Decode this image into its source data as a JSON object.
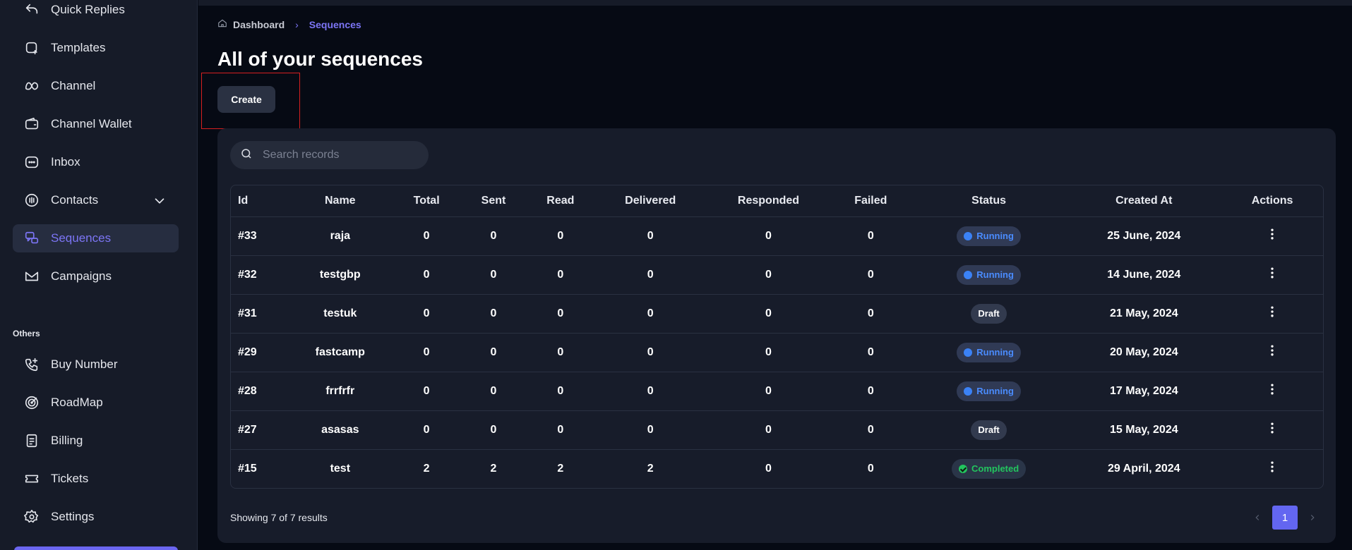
{
  "sidebar": {
    "items": [
      {
        "label": "Quick Replies",
        "icon": "reply-icon"
      },
      {
        "label": "Templates",
        "icon": "template-icon"
      },
      {
        "label": "Channel",
        "icon": "meta-icon"
      },
      {
        "label": "Channel Wallet",
        "icon": "wallet-icon"
      },
      {
        "label": "Inbox",
        "icon": "inbox-icon"
      },
      {
        "label": "Contacts",
        "icon": "contacts-icon"
      },
      {
        "label": "Sequences",
        "icon": "sequences-icon"
      },
      {
        "label": "Campaigns",
        "icon": "campaigns-icon"
      }
    ],
    "section_others": "Others",
    "others_items": [
      {
        "label": "Buy Number",
        "icon": "phone-icon"
      },
      {
        "label": "RoadMap",
        "icon": "target-icon"
      },
      {
        "label": "Billing",
        "icon": "billing-icon"
      },
      {
        "label": "Tickets",
        "icon": "ticket-icon"
      },
      {
        "label": "Settings",
        "icon": "gear-icon"
      }
    ],
    "active": "Sequences"
  },
  "breadcrumb": {
    "home": "Dashboard",
    "current": "Sequences"
  },
  "page": {
    "title": "All of your sequences",
    "create_label": "Create"
  },
  "search": {
    "placeholder": "Search records"
  },
  "table": {
    "columns": [
      "Id",
      "Name",
      "Total",
      "Sent",
      "Read",
      "Delivered",
      "Responded",
      "Failed",
      "Status",
      "Created At",
      "Actions"
    ],
    "rows": [
      {
        "id": "#33",
        "name": "raja",
        "total": "0",
        "sent": "0",
        "read": "0",
        "delivered": "0",
        "responded": "0",
        "failed": "0",
        "status": "Running",
        "created": "25 June, 2024"
      },
      {
        "id": "#32",
        "name": "testgbp",
        "total": "0",
        "sent": "0",
        "read": "0",
        "delivered": "0",
        "responded": "0",
        "failed": "0",
        "status": "Running",
        "created": "14 June, 2024"
      },
      {
        "id": "#31",
        "name": "testuk",
        "total": "0",
        "sent": "0",
        "read": "0",
        "delivered": "0",
        "responded": "0",
        "failed": "0",
        "status": "Draft",
        "created": "21 May, 2024"
      },
      {
        "id": "#29",
        "name": "fastcamp",
        "total": "0",
        "sent": "0",
        "read": "0",
        "delivered": "0",
        "responded": "0",
        "failed": "0",
        "status": "Running",
        "created": "20 May, 2024"
      },
      {
        "id": "#28",
        "name": "frrfrfr",
        "total": "0",
        "sent": "0",
        "read": "0",
        "delivered": "0",
        "responded": "0",
        "failed": "0",
        "status": "Running",
        "created": "17 May, 2024"
      },
      {
        "id": "#27",
        "name": "asasas",
        "total": "0",
        "sent": "0",
        "read": "0",
        "delivered": "0",
        "responded": "0",
        "failed": "0",
        "status": "Draft",
        "created": "15 May, 2024"
      },
      {
        "id": "#15",
        "name": "test",
        "total": "2",
        "sent": "2",
        "read": "2",
        "delivered": "2",
        "responded": "0",
        "failed": "0",
        "status": "Completed",
        "created": "29 April, 2024"
      }
    ]
  },
  "footer": {
    "results_text": "Showing 7 of 7 results",
    "current_page": "1"
  },
  "colors": {
    "accent": "#6366f1",
    "running": "#3b82f6",
    "completed": "#22c55e",
    "highlight": "#d62020"
  }
}
